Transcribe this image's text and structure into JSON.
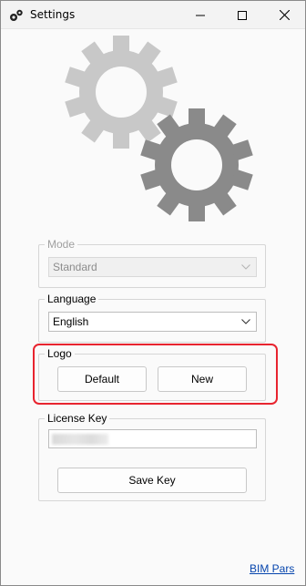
{
  "window": {
    "title": "Settings",
    "icon": "gears-icon",
    "controls": [
      "minimize-icon",
      "maximize-icon",
      "close-icon"
    ]
  },
  "mode": {
    "label": "Mode",
    "value": "Standard",
    "enabled": false
  },
  "language": {
    "label": "Language",
    "value": "English"
  },
  "logo": {
    "label": "Logo",
    "default_label": "Default",
    "new_label": "New"
  },
  "license": {
    "label": "License Key",
    "value": "",
    "save_label": "Save Key"
  },
  "footer": {
    "link_text": "BIM Pars"
  },
  "colors": {
    "highlight": "#e8242f",
    "gear_light": "#c8c8c8",
    "gear_dark": "#8a8a8a",
    "link": "#0645ad"
  }
}
